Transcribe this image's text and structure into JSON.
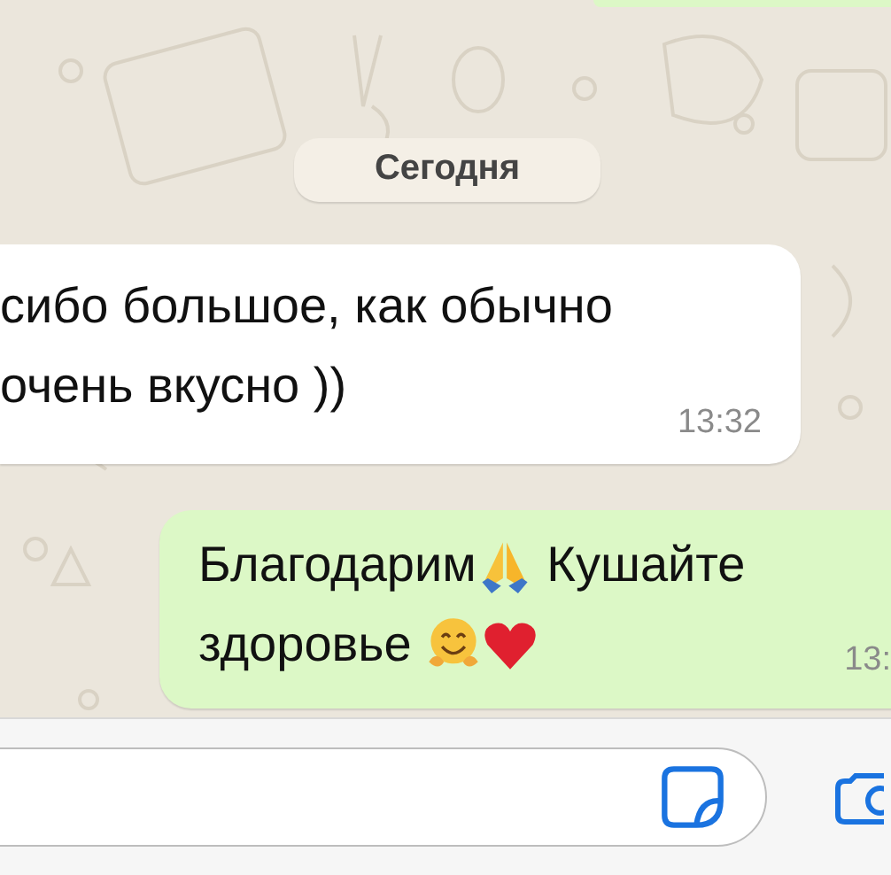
{
  "date_divider": "Сегодня",
  "messages": [
    {
      "kind": "incoming",
      "lines": [
        [
          {
            "kind": "text",
            "text": "сибо большое, как обычно"
          }
        ],
        [
          {
            "kind": "text",
            "text": "очень вкусно ))"
          }
        ]
      ],
      "time": "13:32"
    },
    {
      "kind": "outgoing",
      "lines": [
        [
          {
            "kind": "text",
            "text": "Благодарим"
          },
          {
            "kind": "praying-hands"
          },
          {
            "kind": "text",
            "text": " Кушайте"
          }
        ],
        [
          {
            "kind": "text",
            "text": "здоровье "
          },
          {
            "kind": "hugging-face"
          },
          {
            "kind": "heart"
          }
        ]
      ],
      "time": "13:"
    }
  ]
}
